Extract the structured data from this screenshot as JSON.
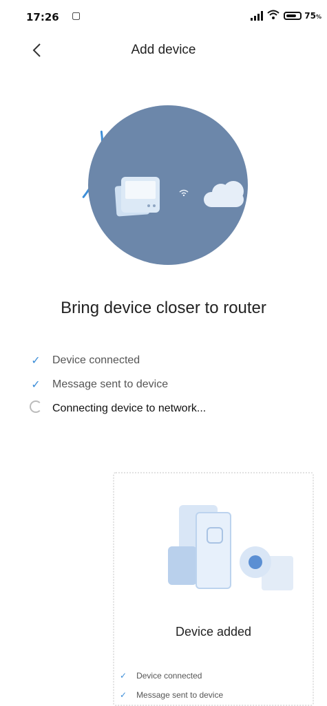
{
  "status_bar": {
    "time": "17:26",
    "app_icon": "mi-home-icon",
    "battery_percent": "75",
    "battery_level": 0.75
  },
  "header": {
    "title": "Add device",
    "back_icon": "chevron-left-icon"
  },
  "hero": {
    "progress": 0.13,
    "colors": {
      "circle": "#6c87aa",
      "arc": "#3d8ed8"
    }
  },
  "main": {
    "headline": "Bring device closer to router",
    "steps": [
      {
        "label": "Device connected",
        "state": "done"
      },
      {
        "label": "Message sent to device",
        "state": "done"
      },
      {
        "label": "Connecting device to network...",
        "state": "in-progress"
      }
    ]
  },
  "preview": {
    "title": "Device added",
    "steps": [
      {
        "label": "Device connected"
      },
      {
        "label": "Message sent to device"
      }
    ]
  }
}
